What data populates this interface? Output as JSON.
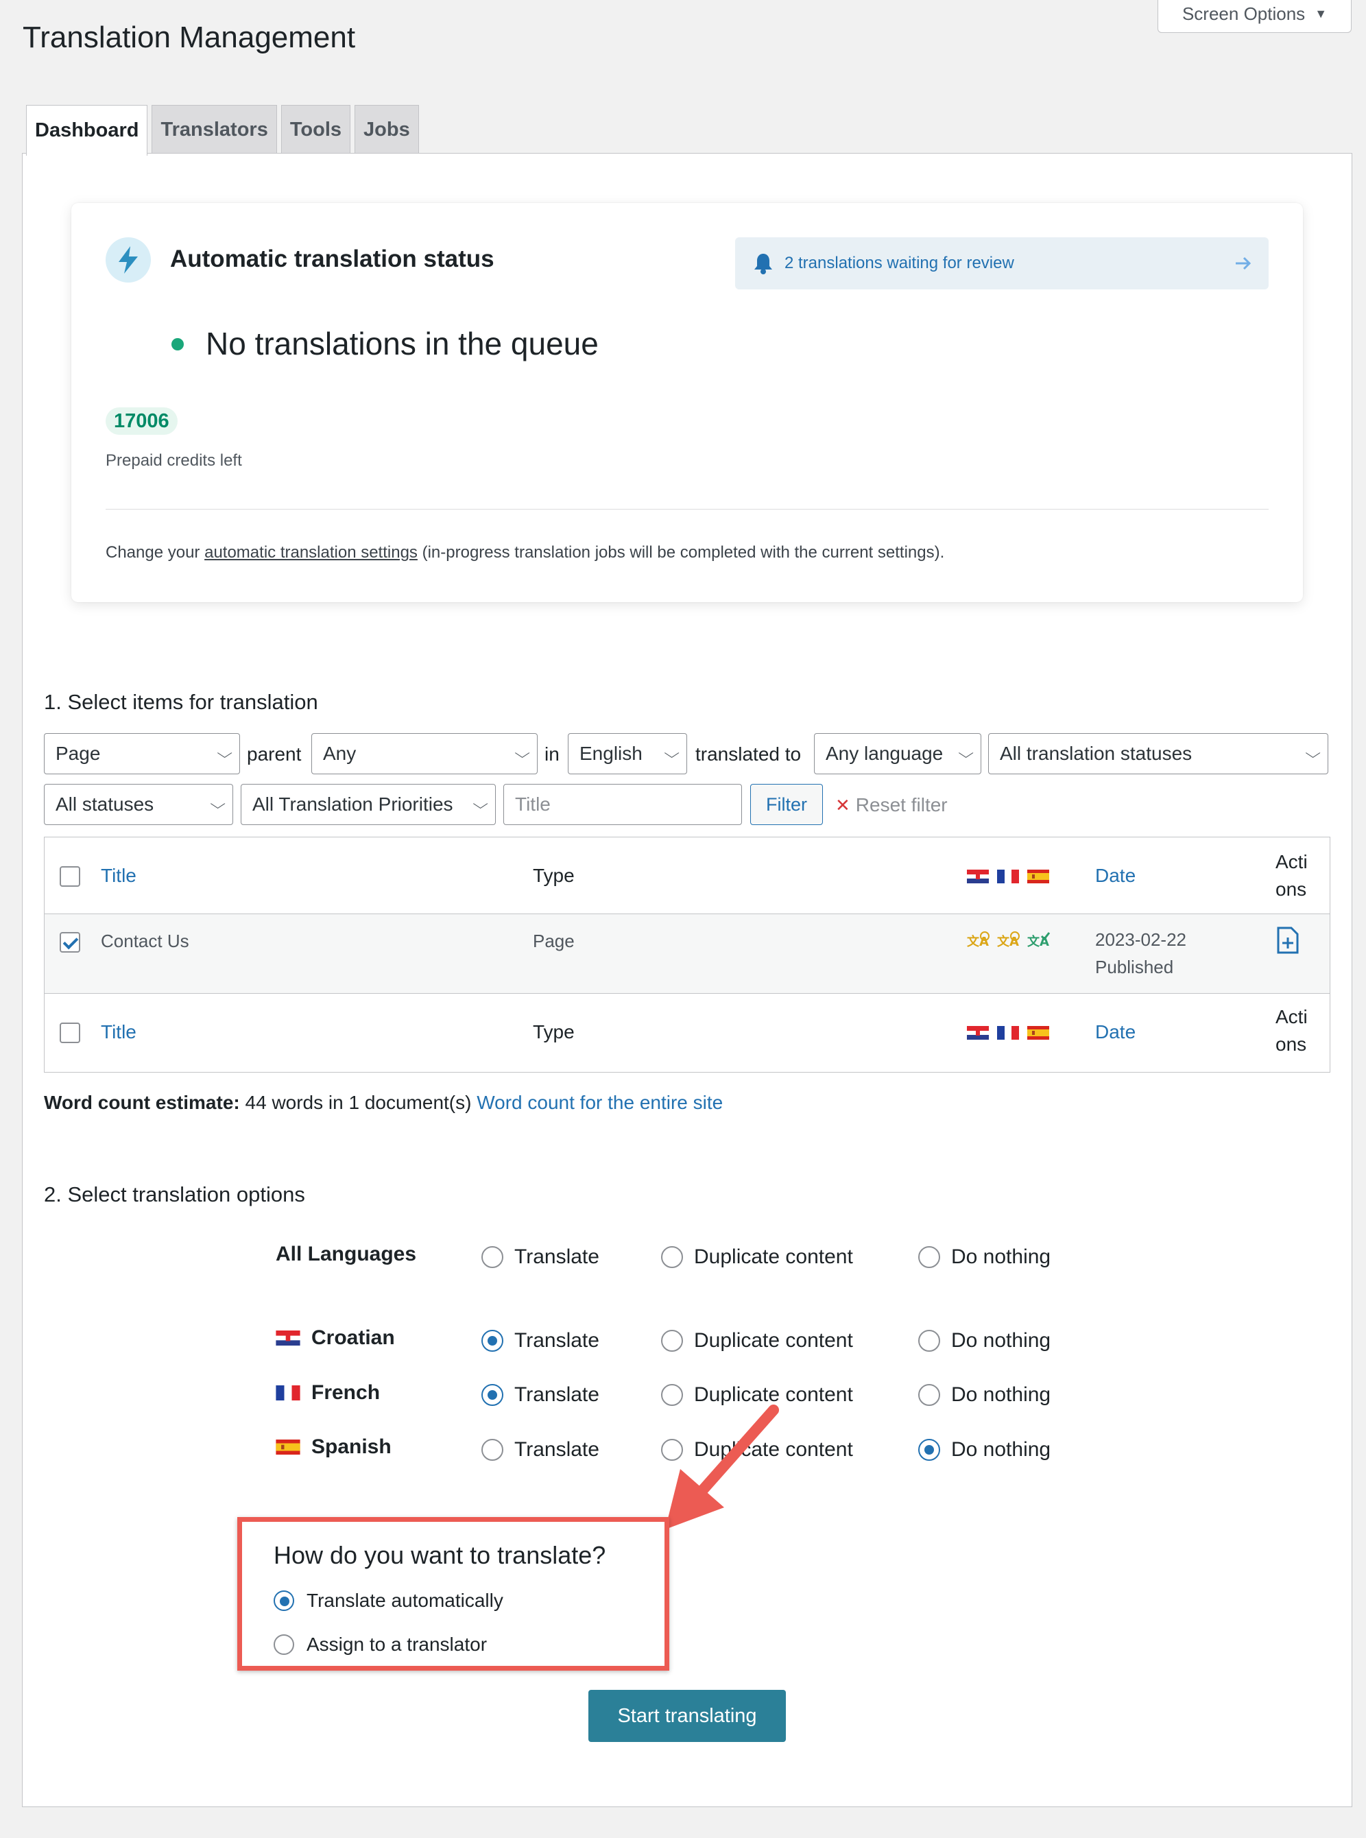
{
  "screen_options": {
    "label": "Screen Options"
  },
  "page_title": "Translation Management",
  "tabs": [
    {
      "label": "Dashboard",
      "active": true
    },
    {
      "label": "Translators",
      "active": false
    },
    {
      "label": "Tools",
      "active": false
    },
    {
      "label": "Jobs",
      "active": false
    }
  ],
  "status_card": {
    "title": "Automatic translation status",
    "review_notice": "2 translations waiting for review",
    "queue_text": "No translations in the queue",
    "credits": "17006",
    "credits_label": "Prepaid credits left",
    "footer_prefix": "Change your ",
    "footer_link": "automatic translation settings",
    "footer_suffix": " (in-progress translation jobs will be completed with the current settings)."
  },
  "section1": {
    "title": "1. Select items for translation",
    "filters": {
      "type": "Page",
      "parent_label": "parent",
      "parent": "Any",
      "in_label": "in",
      "language": "English",
      "translated_to_label": "translated to",
      "target_language": "Any language",
      "translation_status": "All translation statuses",
      "post_status": "All statuses",
      "priority": "All Translation Priorities",
      "title_placeholder": "Title",
      "filter_button": "Filter",
      "reset_label": "Reset filter"
    },
    "table": {
      "headers": {
        "title": "Title",
        "type": "Type",
        "date": "Date",
        "actions_1": "Acti",
        "actions_2": "ons"
      },
      "rows": [
        {
          "title": "Contact Us",
          "type": "Page",
          "date": "2023-02-22",
          "status": "Published",
          "checked": true
        }
      ]
    },
    "word_count_label": "Word count estimate:",
    "word_count_text": " 44 words in 1 document(s) ",
    "word_count_link": "Word count for the entire site"
  },
  "section2": {
    "title": "2. Select translation options",
    "option_labels": {
      "translate": "Translate",
      "duplicate": "Duplicate content",
      "nothing": "Do nothing"
    },
    "languages": [
      {
        "name": "All Languages",
        "selected": "none"
      },
      {
        "name": "Croatian",
        "selected": "translate"
      },
      {
        "name": "French",
        "selected": "translate"
      },
      {
        "name": "Spanish",
        "selected": "nothing"
      }
    ],
    "how_question": "How do you want to translate?",
    "how_options": [
      {
        "label": "Translate automatically",
        "selected": true
      },
      {
        "label": "Assign to a translator",
        "selected": false
      }
    ],
    "start_button": "Start translating"
  },
  "colors": {
    "accent": "#2271b1",
    "primary_button": "#2b8098",
    "highlight": "#ec5b53",
    "success": "#1aa77a"
  }
}
